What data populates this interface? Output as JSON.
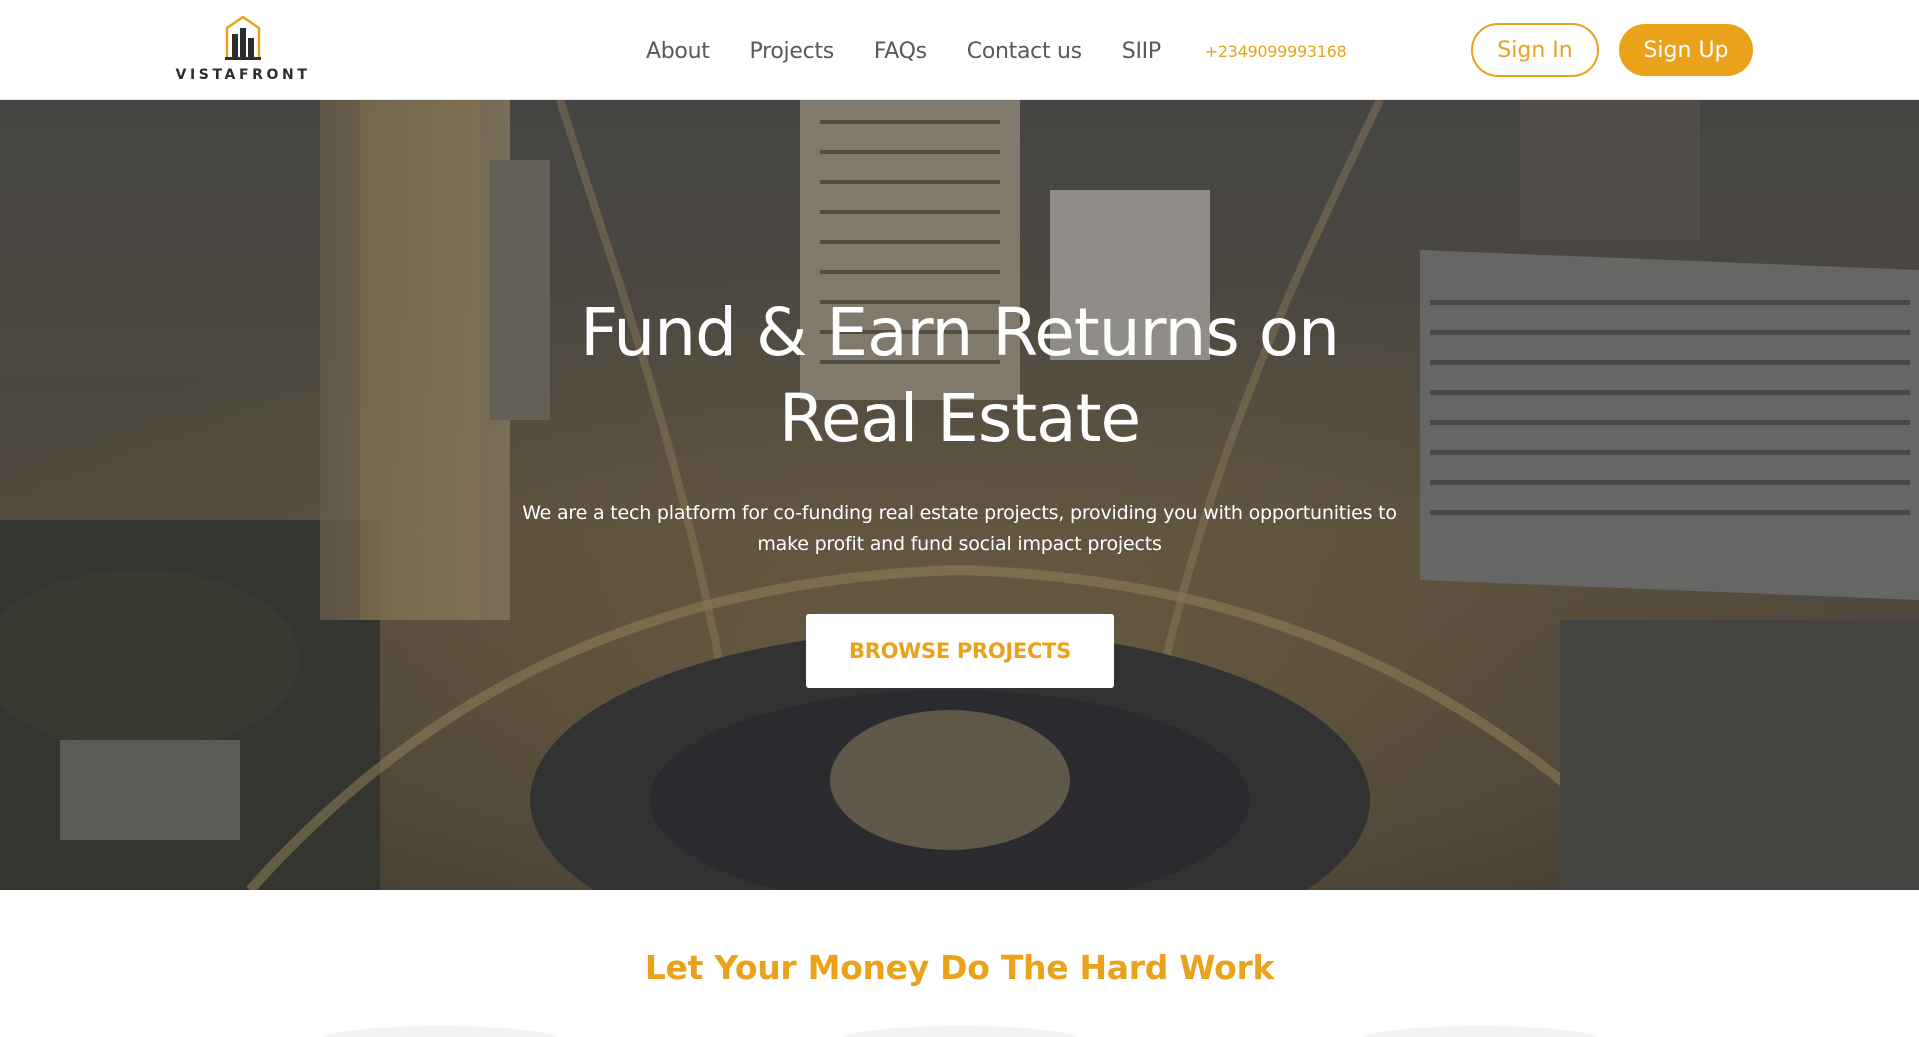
{
  "brand": {
    "name": "VISTAFRONT",
    "logo_icon": "building-icon",
    "accent": "#eaa21b"
  },
  "nav": {
    "links": [
      "About",
      "Projects",
      "FAQs",
      "Contact us",
      "SIIP"
    ],
    "phone": "+2349099993168"
  },
  "auth": {
    "sign_in": "Sign In",
    "sign_up": "Sign Up"
  },
  "hero": {
    "title_line1": "Fund & Earn Returns on",
    "title_line2": "Real Estate",
    "subtitle": "We are a tech platform for co-funding real estate projects, providing you with opportunities to make profit and fund social impact projects",
    "cta": "BROWSE PROJECTS"
  },
  "section": {
    "title": "Let Your Money Do The Hard Work"
  }
}
